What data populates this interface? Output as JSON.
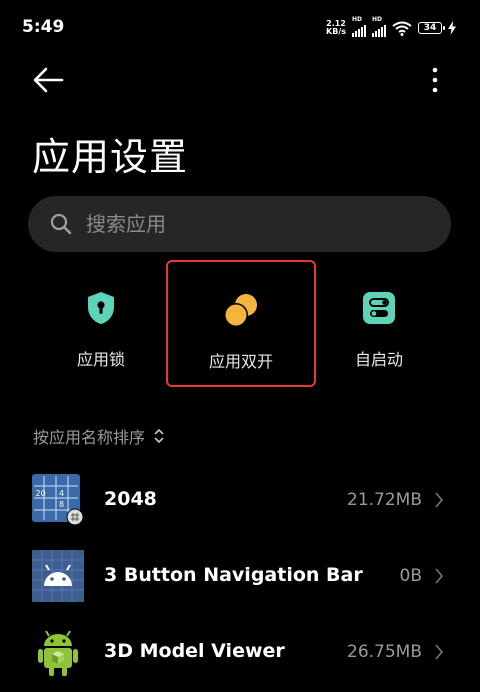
{
  "status": {
    "time": "5:49",
    "speed_top": "2.12",
    "speed_bottom": "KB/s",
    "hd": "HD",
    "battery": "34"
  },
  "header": {
    "title": "应用设置"
  },
  "search": {
    "placeholder": "搜索应用"
  },
  "quick_actions": [
    {
      "label": "应用锁",
      "icon": "shield-lock-icon",
      "color": "#5fd3b8"
    },
    {
      "label": "应用双开",
      "icon": "dual-circles-icon",
      "color": "#f5b53d",
      "highlighted": true
    },
    {
      "label": "自启动",
      "icon": "toggle-switch-icon",
      "color": "#5fd3b8"
    }
  ],
  "sort": {
    "label": "按应用名称排序"
  },
  "apps": [
    {
      "name": "2048",
      "size": "21.72MB",
      "icon": "2048-grid-icon"
    },
    {
      "name": "3 Button Navigation Bar",
      "size": "0B",
      "icon": "android-robot-icon"
    },
    {
      "name": "3D Model Viewer",
      "size": "26.75MB",
      "icon": "android-cube-icon"
    }
  ],
  "colors": {
    "background": "#000000",
    "search_bg": "#262626",
    "highlight_border": "#e53935",
    "secondary_text": "#9a9a9a"
  }
}
